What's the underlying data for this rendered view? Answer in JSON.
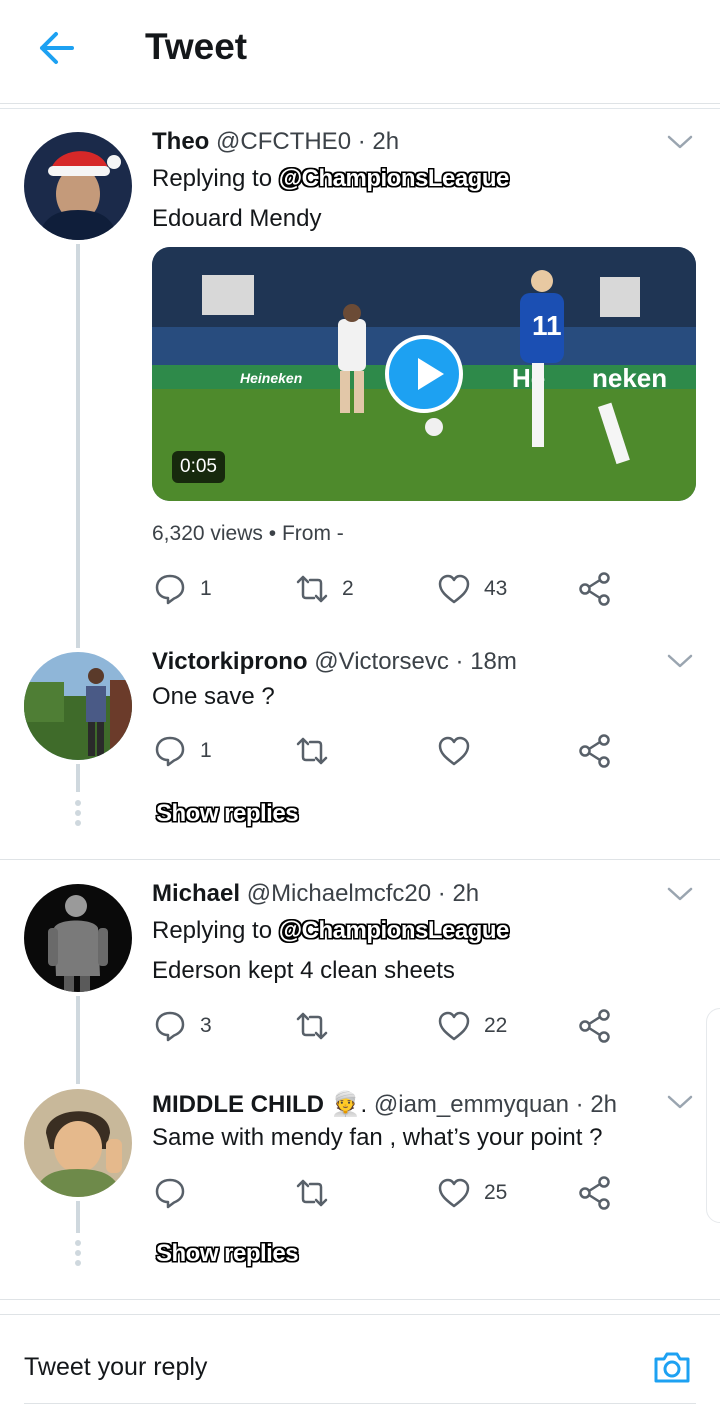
{
  "header": {
    "title": "Tweet"
  },
  "tweets": [
    {
      "name": "Theo",
      "handle": "@CFCTHE0",
      "time": "· 2h",
      "replying_prefix": "Replying to",
      "replying_to": "@ChampionsLeague",
      "text": "Edouard Mendy",
      "video": {
        "duration": "0:05"
      },
      "views": "6,320 views",
      "from": "From -",
      "replies": "1",
      "retweets": "2",
      "likes": "43"
    },
    {
      "name": "Victorkiprono",
      "handle": "@Victorsevc",
      "time": "· 18m",
      "text": "One save ?",
      "replies": "1",
      "retweets": "",
      "likes": "",
      "show_replies": "Show replies"
    },
    {
      "name": "Michael",
      "handle": "@Michaelmcfc20",
      "time": "· 2h",
      "replying_prefix": "Replying to",
      "replying_to": "@ChampionsLeague",
      "text": "Ederson kept 4 clean sheets",
      "replies": "3",
      "retweets": "",
      "likes": "22"
    },
    {
      "name": "MIDDLE CHILD",
      "emoji": "👳.",
      "handle": "@iam_emmyquan",
      "time": "· 2h",
      "text": "Same with mendy fan , what’s your point ?",
      "replies": "",
      "retweets": "",
      "likes": "25",
      "show_replies": "Show replies"
    }
  ],
  "composer": {
    "placeholder": "Tweet your reply"
  },
  "colors": {
    "accent": "#1da1f2",
    "text": "#14171a",
    "muted": "#3c4248",
    "line": "#cfd8de"
  },
  "icons": [
    "back-arrow-icon",
    "chevron-down-icon",
    "reply-icon",
    "retweet-icon",
    "like-icon",
    "share-icon",
    "play-icon",
    "camera-icon"
  ]
}
